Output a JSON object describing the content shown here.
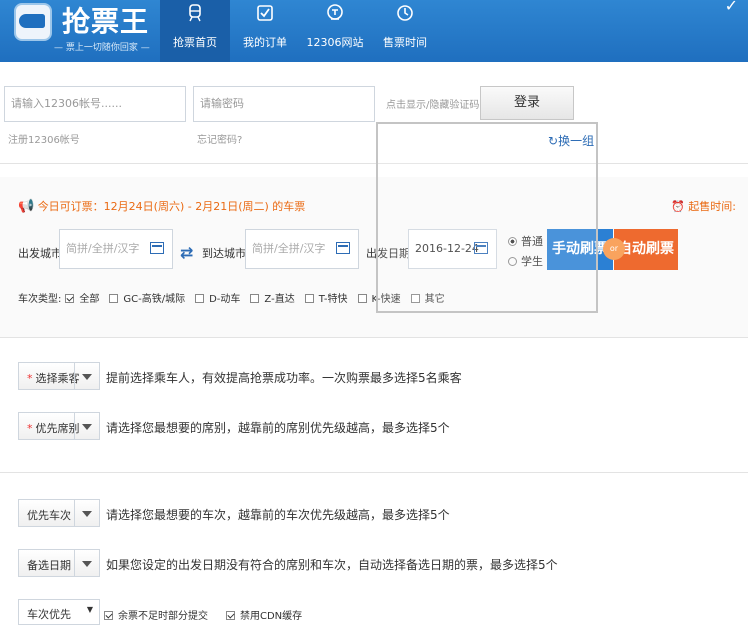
{
  "app": {
    "title": "抢票王",
    "slogan": "— 票上一切随你回家 —"
  },
  "nav": {
    "items": [
      {
        "label": "抢票首页",
        "icon": "train-icon"
      },
      {
        "label": "我的订单",
        "icon": "order-check-icon"
      },
      {
        "label": "12306网站",
        "icon": "web-icon"
      },
      {
        "label": "售票时间",
        "icon": "clock-icon"
      }
    ]
  },
  "login": {
    "account_placeholder": "请输入12306帐号......",
    "password_placeholder": "请输密码",
    "register_link": "注册12306帐号",
    "forgot_link": "忘记密码?",
    "captcha_hint": "点击显示/隐藏验证码",
    "login_button": "登录",
    "refresh_captcha": "换一组"
  },
  "query": {
    "notice": "今日可订票：12月24日(周六) - 2月21日(周二) 的车票",
    "start_time_label": "起售时间:",
    "from_label": "出发城市",
    "from_placeholder": "简拼/全拼/汉字",
    "to_label": "到达城市",
    "to_placeholder": "简拼/全拼/汉字",
    "date_label": "出发日期",
    "date_value": "2016-12-24",
    "ticket_type_normal": "普通",
    "ticket_type_student": "学生",
    "manual_button": "手动刷票",
    "or_label": "or",
    "auto_button": "自动刷票",
    "train_type_label": "车次类型:",
    "train_types": [
      "全部",
      "GC-高铁/城际",
      "D-动车",
      "Z-直达",
      "T-特快",
      "K-快速",
      "其它"
    ]
  },
  "options": {
    "passenger_select": "选择乘客",
    "passenger_desc": "提前选择乘车人，有效提高抢票成功率。一次购票最多选择5名乘客",
    "seat_select": "优先席别",
    "seat_desc": "请选择您最想要的席别，越靠前的席别优先级越高，最多选择5个",
    "train_select": "优先车次",
    "train_desc": "请选择您最想要的车次，越靠前的车次优先级越高，最多选择5个",
    "date_select": "备选日期",
    "date_desc": "如果您设定的出发日期没有符合的席别和车次，自动选择备选日期的票，最多选择5个",
    "priority_select": "车次优先",
    "partial_submit": "余票不足时部分提交",
    "disable_cdn": "禁用CDN缓存"
  },
  "colors": {
    "primary": "#1f6fbf",
    "orange": "#ea6a13",
    "manual_btn": "#2b80d4",
    "auto_btn": "#ee6a2f"
  }
}
